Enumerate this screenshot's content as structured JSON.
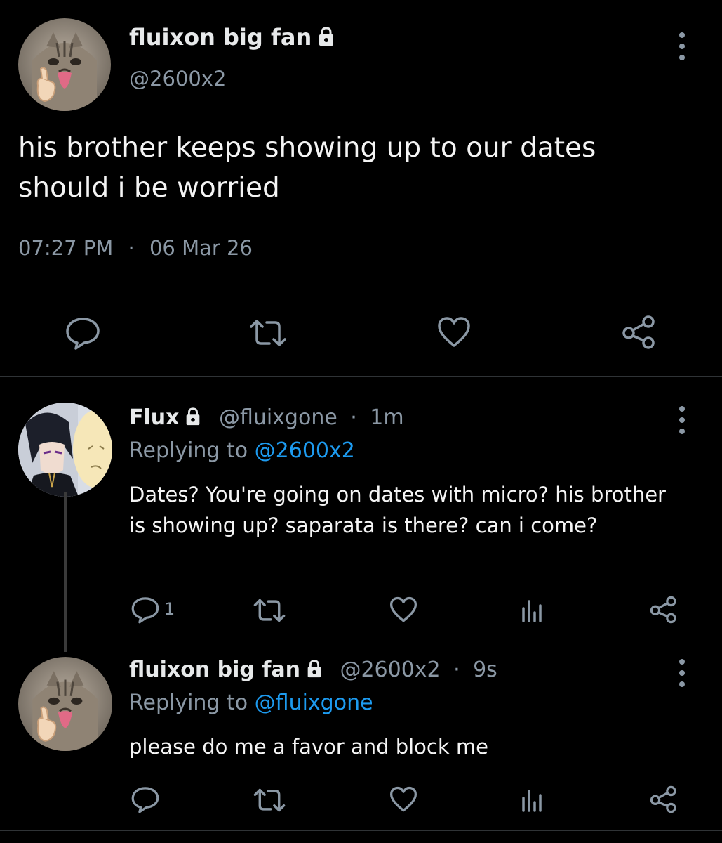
{
  "main_tweet": {
    "display_name": "fluixon big fan",
    "handle": "@2600x2",
    "text_line1": "his brother keeps showing up to our dates",
    "text_line2": "should i be worried",
    "time": "07:27 PM",
    "separator": "·",
    "date": "06 Mar 26",
    "protected": true
  },
  "reply1": {
    "display_name": "Flux",
    "handle": "@fluixgone",
    "separator": "·",
    "age": "1m",
    "replying_label": "Replying to ",
    "replying_to": "@2600x2",
    "text": "Dates? You're going on dates with micro? his brother is showing up? saparata is there? can i come?",
    "reply_count": "1",
    "protected": true
  },
  "reply2": {
    "display_name": "fluixon big fan",
    "handle": "@2600x2",
    "separator": "·",
    "age": "9s",
    "replying_label": "Replying to ",
    "replying_to": "@fluixgone",
    "text": "please do me a favor and block me",
    "protected": true
  },
  "icons": {
    "reply": "reply-bubble-icon",
    "retweet": "retweet-icon",
    "like": "heart-icon",
    "views": "bar-chart-icon",
    "share": "share-icon",
    "menu": "more-vertical-icon",
    "lock": "lock-icon"
  },
  "colors": {
    "background": "#000000",
    "text": "#e7e9ea",
    "muted": "#8b98a5",
    "link": "#1d9bf0",
    "divider": "#2f3336"
  }
}
